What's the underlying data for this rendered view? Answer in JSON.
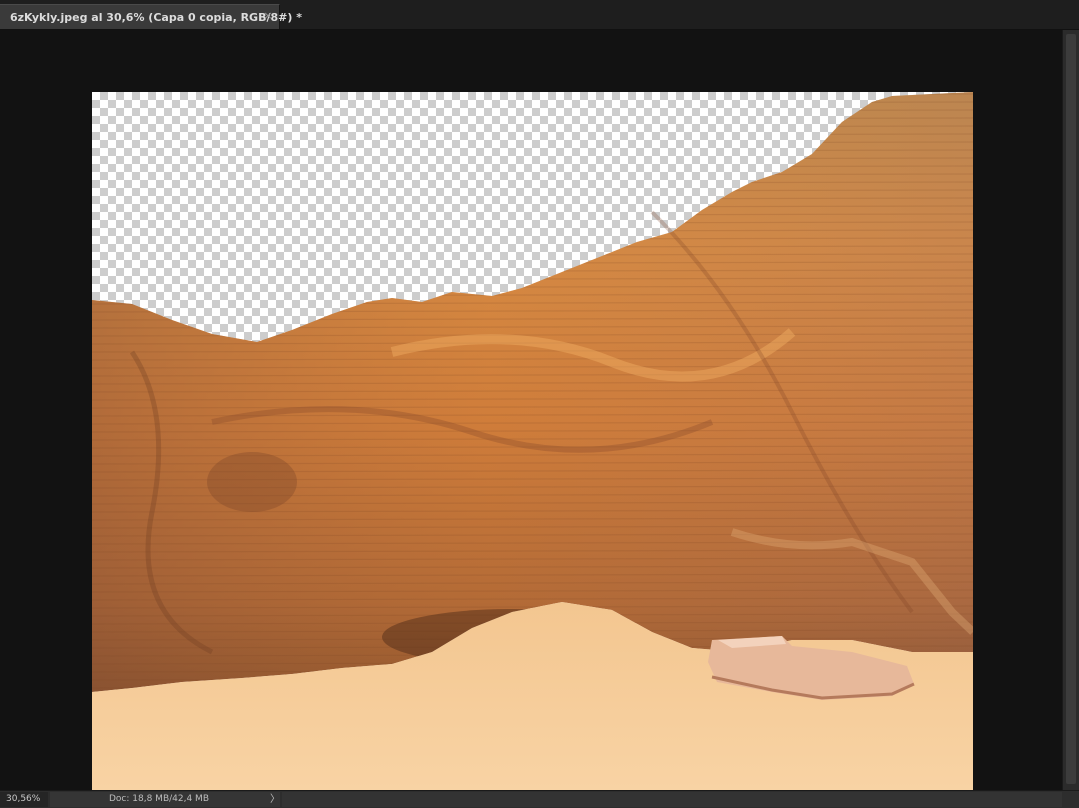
{
  "document_tab": {
    "title": "6zKykly.jpeg al 30,6% (Capa 0 copia, RGB/8#) *",
    "close_glyph": "×"
  },
  "canvas": {
    "image_description_icon": "photo-rock-cliff"
  },
  "statusbar": {
    "zoom": "30,56%",
    "doc_info": "Doc: 18,8 MB/42,4 MB",
    "arrow_glyph": "〉"
  },
  "colors": {
    "workspace": "#121212",
    "chrome": "#282828",
    "tab_active": "#3a3a3a",
    "rock_main": "#c97a3a",
    "sand": "#f2c98f"
  }
}
